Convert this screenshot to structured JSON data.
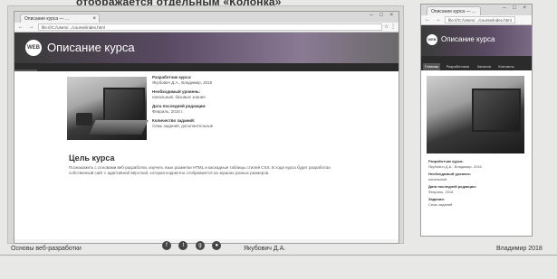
{
  "caption": "отображается отдельным «Колонка»",
  "browser": {
    "tab_title": "Описание курса — ...",
    "tab_close": "×",
    "win_buttons": "– □ ×",
    "nav_icons": "← → C",
    "url": "file:///C:/Users/.../course/index.html",
    "addr_icons": "☆ ⋮"
  },
  "site": {
    "logo": "WEB",
    "title": "Описание курса",
    "nav": [
      "Главная",
      "Разработчики",
      "Занятия",
      "Контакты",
      "Дополнительные материалы"
    ]
  },
  "info": [
    {
      "label": "Разработчик курса:",
      "value": "Якубович Д.А., Владимир, 2018"
    },
    {
      "label": "Необходимый уровень:",
      "value": "начальный, базовые знания"
    },
    {
      "label": "Дата последней редакции:",
      "value": "Февраль, 2018 г."
    },
    {
      "label": "Количество заданий:",
      "value": "Семь заданий, дополнительные"
    }
  ],
  "goal": {
    "title": "Цель курса",
    "text": "Познакомить с основами веб-разработки, изучить язык разметки HTML и каскадные таблицы стилей CSS. В ходе курса будет разработан собственный сайт с адаптивной вёрсткой, которая корректно отображается на экранах разных размеров."
  },
  "social_icons": [
    "facebook-icon",
    "twitter-icon",
    "google-icon",
    "github-icon"
  ],
  "social_glyphs": [
    "f",
    "t",
    "g",
    "●"
  ],
  "right": {
    "logo": "WEB",
    "title": "Описание курса",
    "nav": [
      "Главная",
      "Разработчики",
      "Занятия",
      "Контакты",
      "Дополнительные материалы"
    ],
    "info": [
      {
        "label": "Разработчик курса:",
        "value": "Якубович Д.А., Владимир, 2018"
      },
      {
        "label": "Необходимый уровень:",
        "value": "начальный"
      },
      {
        "label": "Дата последней редакции:",
        "value": "Февраль, 2018"
      },
      {
        "label": "Задания:",
        "value": "Семь заданий"
      }
    ]
  },
  "footer": {
    "left": "Основы веб-разработки",
    "middle": "Якубович Д.А.",
    "right": "Владимир 2018"
  }
}
